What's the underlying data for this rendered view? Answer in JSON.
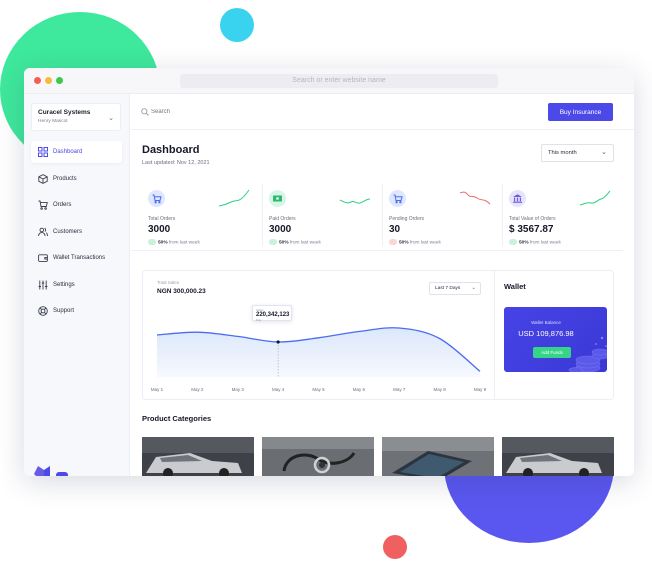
{
  "browser": {
    "url_placeholder": "Search or enter website name"
  },
  "sidebar": {
    "org_name": "Curacel Systems",
    "org_user": "Henry Mascot",
    "items": [
      {
        "label": "Dashboard",
        "icon": "grid-icon",
        "active": true
      },
      {
        "label": "Products",
        "icon": "box-icon",
        "active": false
      },
      {
        "label": "Orders",
        "icon": "cart-icon",
        "active": false
      },
      {
        "label": "Customers",
        "icon": "users-icon",
        "active": false
      },
      {
        "label": "Wallet Transactions",
        "icon": "wallet-icon",
        "active": false
      },
      {
        "label": "Settings",
        "icon": "sliders-icon",
        "active": false
      },
      {
        "label": "Support",
        "icon": "lifebuoy-icon",
        "active": false
      }
    ]
  },
  "header": {
    "search_placeholder": "Search",
    "buy_label": "Buy Insurance"
  },
  "dashboard": {
    "title": "Dashboard",
    "updated": "Last updated: Nov 12, 2021",
    "period": "This month"
  },
  "stats": [
    {
      "label": "Total Orders",
      "value": "3000",
      "pct": "50%",
      "suffix": "from last week",
      "icon": "cart-icon",
      "icon_bg": "#dfe6ff",
      "icon_color": "#4b6cf0",
      "trend": "up"
    },
    {
      "label": "Paid Orders",
      "value": "3000",
      "pct": "50%",
      "suffix": "from last week",
      "icon": "cash-icon",
      "icon_bg": "#d6f5e6",
      "icon_color": "#2fb872",
      "trend": "up"
    },
    {
      "label": "Pending Orders",
      "value": "30",
      "pct": "50%",
      "suffix": "from last week",
      "icon": "cart-icon",
      "icon_bg": "#dfe6ff",
      "icon_color": "#4b6cf0",
      "trend": "down"
    },
    {
      "label": "Total Value of Orders",
      "value": "$ 3567.87",
      "pct": "50%",
      "suffix": "from last week",
      "icon": "bank-icon",
      "icon_bg": "#e6e3fb",
      "icon_color": "#6a5be6",
      "trend": "up"
    }
  ],
  "sales": {
    "label": "Total Sales",
    "total": "NGN 300,000.23",
    "range": "Last 7 Days",
    "tooltip_label": "Sales",
    "tooltip_value": "220,342,123",
    "tooltip_sub": "May"
  },
  "chart_data": {
    "type": "area",
    "categories": [
      "May 1",
      "May 2",
      "May 3",
      "May 4",
      "May 5",
      "May 6",
      "May 7",
      "May 8",
      "May 9"
    ],
    "values": [
      60,
      64,
      58,
      50,
      56,
      65,
      70,
      55,
      8
    ],
    "ylim": [
      0,
      100
    ],
    "highlight_index": 3,
    "grid": false,
    "line_color": "#4b6cf0",
    "fill_color": "#dbe7fb"
  },
  "wallet": {
    "title": "Wallet",
    "balance_label": "Wallet Balance",
    "balance": "USD 109,876.98",
    "add_label": "Add Funds"
  },
  "categories": {
    "title": "Product Categories"
  }
}
